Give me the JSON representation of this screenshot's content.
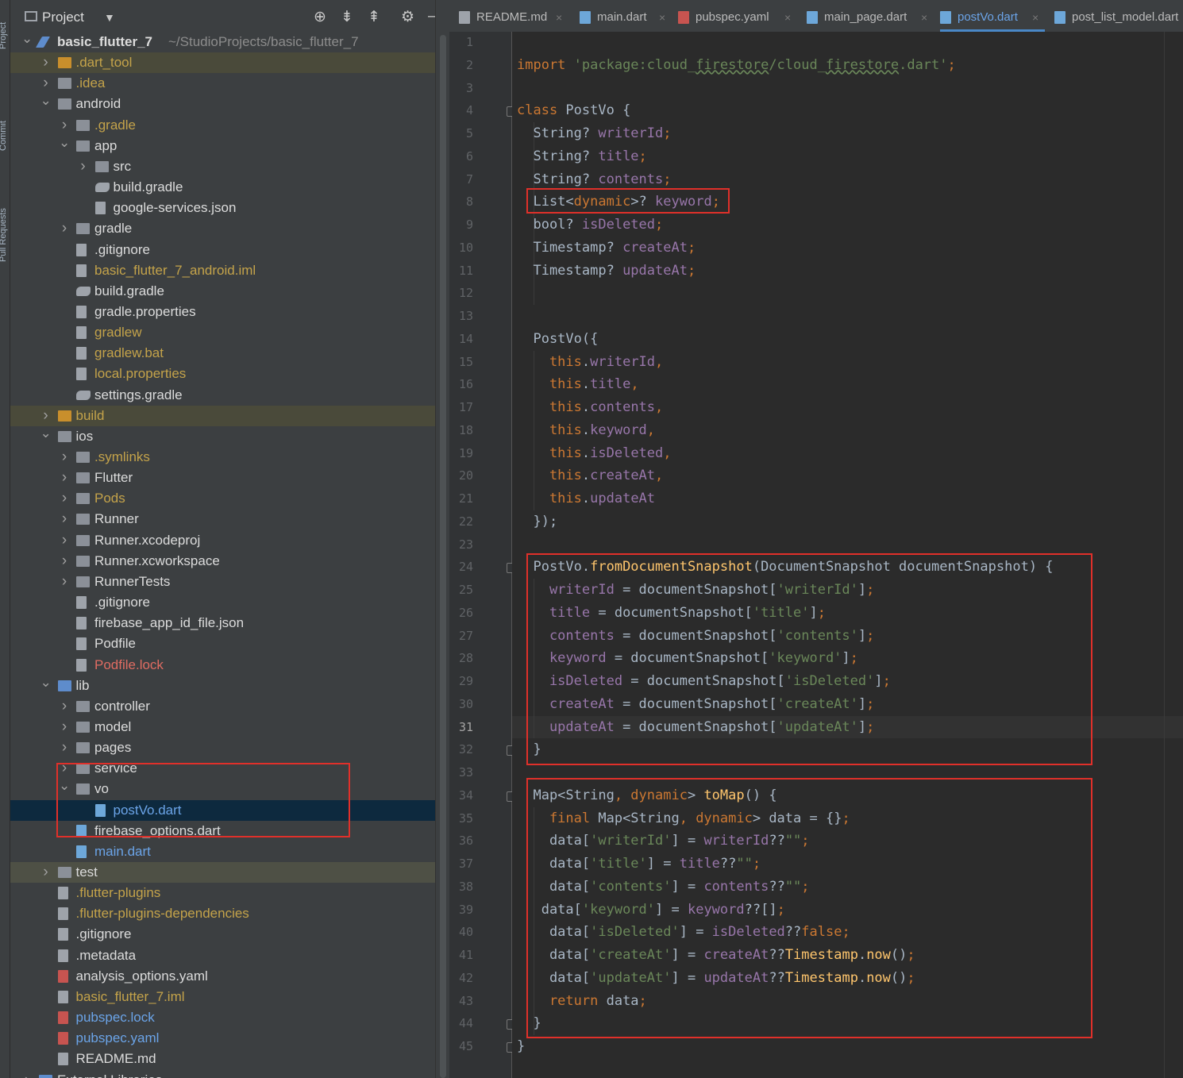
{
  "sidebar_strip": {
    "tabs": [
      "Project",
      "Commit",
      "Pull Requests"
    ]
  },
  "project_panel": {
    "title": "Project",
    "tree": [
      {
        "depth": 0,
        "arrow": "down",
        "icon": "flutter",
        "label": "basic_flutter_7",
        "extra": "~/StudioProjects/basic_flutter_7",
        "color": "norm",
        "bold": true
      },
      {
        "depth": 1,
        "arrow": "right",
        "icon": "folder-orange",
        "label": ".dart_tool",
        "color": "ign",
        "hl": true
      },
      {
        "depth": 1,
        "arrow": "right",
        "icon": "folder",
        "label": ".idea",
        "color": "ign"
      },
      {
        "depth": 1,
        "arrow": "down",
        "icon": "folder",
        "label": "android",
        "color": "norm"
      },
      {
        "depth": 2,
        "arrow": "right",
        "icon": "folder",
        "label": ".gradle",
        "color": "ign"
      },
      {
        "depth": 2,
        "arrow": "down",
        "icon": "folder",
        "label": "app",
        "color": "norm"
      },
      {
        "depth": 3,
        "arrow": "right",
        "icon": "folder",
        "label": "src",
        "color": "norm"
      },
      {
        "depth": 3,
        "arrow": "",
        "icon": "gradle",
        "label": "build.gradle",
        "color": "norm"
      },
      {
        "depth": 3,
        "arrow": "",
        "icon": "file",
        "label": "google-services.json",
        "color": "norm"
      },
      {
        "depth": 2,
        "arrow": "right",
        "icon": "folder",
        "label": "gradle",
        "color": "norm"
      },
      {
        "depth": 2,
        "arrow": "",
        "icon": "file",
        "label": ".gitignore",
        "color": "norm"
      },
      {
        "depth": 2,
        "arrow": "",
        "icon": "file",
        "label": "basic_flutter_7_android.iml",
        "color": "ign"
      },
      {
        "depth": 2,
        "arrow": "",
        "icon": "gradle",
        "label": "build.gradle",
        "color": "norm"
      },
      {
        "depth": 2,
        "arrow": "",
        "icon": "file",
        "label": "gradle.properties",
        "color": "norm"
      },
      {
        "depth": 2,
        "arrow": "",
        "icon": "file",
        "label": "gradlew",
        "color": "ign"
      },
      {
        "depth": 2,
        "arrow": "",
        "icon": "file",
        "label": "gradlew.bat",
        "color": "ign"
      },
      {
        "depth": 2,
        "arrow": "",
        "icon": "file",
        "label": "local.properties",
        "color": "ign"
      },
      {
        "depth": 2,
        "arrow": "",
        "icon": "gradle",
        "label": "settings.gradle",
        "color": "norm"
      },
      {
        "depth": 1,
        "arrow": "right",
        "icon": "folder-orange",
        "label": "build",
        "color": "ign",
        "hl": true
      },
      {
        "depth": 1,
        "arrow": "down",
        "icon": "folder",
        "label": "ios",
        "color": "norm"
      },
      {
        "depth": 2,
        "arrow": "right",
        "icon": "folder",
        "label": ".symlinks",
        "color": "ign"
      },
      {
        "depth": 2,
        "arrow": "right",
        "icon": "folder",
        "label": "Flutter",
        "color": "norm"
      },
      {
        "depth": 2,
        "arrow": "right",
        "icon": "folder",
        "label": "Pods",
        "color": "ign"
      },
      {
        "depth": 2,
        "arrow": "right",
        "icon": "folder",
        "label": "Runner",
        "color": "norm"
      },
      {
        "depth": 2,
        "arrow": "right",
        "icon": "folder",
        "label": "Runner.xcodeproj",
        "color": "norm"
      },
      {
        "depth": 2,
        "arrow": "right",
        "icon": "folder",
        "label": "Runner.xcworkspace",
        "color": "norm"
      },
      {
        "depth": 2,
        "arrow": "right",
        "icon": "folder",
        "label": "RunnerTests",
        "color": "norm"
      },
      {
        "depth": 2,
        "arrow": "",
        "icon": "file",
        "label": ".gitignore",
        "color": "norm"
      },
      {
        "depth": 2,
        "arrow": "",
        "icon": "file",
        "label": "firebase_app_id_file.json",
        "color": "norm"
      },
      {
        "depth": 2,
        "arrow": "",
        "icon": "file",
        "label": "Podfile",
        "color": "norm"
      },
      {
        "depth": 2,
        "arrow": "",
        "icon": "file",
        "label": "Podfile.lock",
        "color": "red"
      },
      {
        "depth": 1,
        "arrow": "down",
        "icon": "folder-blue",
        "label": "lib",
        "color": "norm"
      },
      {
        "depth": 2,
        "arrow": "right",
        "icon": "folder",
        "label": "controller",
        "color": "norm"
      },
      {
        "depth": 2,
        "arrow": "right",
        "icon": "folder",
        "label": "model",
        "color": "norm"
      },
      {
        "depth": 2,
        "arrow": "right",
        "icon": "folder",
        "label": "pages",
        "color": "norm"
      },
      {
        "depth": 2,
        "arrow": "right",
        "icon": "folder",
        "label": "service",
        "color": "norm"
      },
      {
        "depth": 2,
        "arrow": "down",
        "icon": "folder",
        "label": "vo",
        "color": "norm"
      },
      {
        "depth": 3,
        "arrow": "",
        "icon": "dart",
        "label": "postVo.dart",
        "color": "blue",
        "sel": true
      },
      {
        "depth": 2,
        "arrow": "",
        "icon": "dart",
        "label": "firebase_options.dart",
        "color": "norm"
      },
      {
        "depth": 2,
        "arrow": "",
        "icon": "dart",
        "label": "main.dart",
        "color": "blue"
      },
      {
        "depth": 1,
        "arrow": "right",
        "icon": "folder",
        "label": "test",
        "color": "norm",
        "hl2": true
      },
      {
        "depth": 1,
        "arrow": "",
        "icon": "file",
        "label": ".flutter-plugins",
        "color": "ign"
      },
      {
        "depth": 1,
        "arrow": "",
        "icon": "file",
        "label": ".flutter-plugins-dependencies",
        "color": "ign"
      },
      {
        "depth": 1,
        "arrow": "",
        "icon": "file",
        "label": ".gitignore",
        "color": "norm"
      },
      {
        "depth": 1,
        "arrow": "",
        "icon": "file",
        "label": ".metadata",
        "color": "norm"
      },
      {
        "depth": 1,
        "arrow": "",
        "icon": "yaml",
        "label": "analysis_options.yaml",
        "color": "norm"
      },
      {
        "depth": 1,
        "arrow": "",
        "icon": "file",
        "label": "basic_flutter_7.iml",
        "color": "ign"
      },
      {
        "depth": 1,
        "arrow": "",
        "icon": "yaml",
        "label": "pubspec.lock",
        "color": "blue"
      },
      {
        "depth": 1,
        "arrow": "",
        "icon": "yaml",
        "label": "pubspec.yaml",
        "color": "blue"
      },
      {
        "depth": 1,
        "arrow": "",
        "icon": "file",
        "label": "README.md",
        "color": "norm"
      },
      {
        "depth": 0,
        "arrow": "right",
        "icon": "lib",
        "label": "External Libraries",
        "color": "norm"
      }
    ]
  },
  "editor_tabs": [
    {
      "label": "README.md",
      "icon": "md",
      "active": false
    },
    {
      "label": "main.dart",
      "icon": "dart",
      "active": false
    },
    {
      "label": "pubspec.yaml",
      "icon": "yaml",
      "active": false
    },
    {
      "label": "main_page.dart",
      "icon": "dart",
      "active": false
    },
    {
      "label": "postVo.dart",
      "icon": "dart",
      "active": true
    },
    {
      "label": "post_list_model.dart",
      "icon": "dart",
      "active": false
    }
  ],
  "editor": {
    "current_line": 31,
    "lines": [
      [],
      [
        [
          "kw",
          "import "
        ],
        [
          "str",
          "'package:cloud_"
        ],
        [
          "str ul",
          "firestore"
        ],
        [
          "str",
          "/cloud_"
        ],
        [
          "str ul",
          "firestore"
        ],
        [
          "str",
          ".dart'"
        ],
        [
          "kw",
          ";"
        ]
      ],
      [],
      [
        [
          "kw",
          "class "
        ],
        [
          "ty",
          "PostVo {"
        ]
      ],
      [
        [
          "ty",
          "  String? "
        ],
        [
          "fld",
          "writerId"
        ],
        [
          "kw",
          ";"
        ]
      ],
      [
        [
          "ty",
          "  String? "
        ],
        [
          "fld",
          "title"
        ],
        [
          "kw",
          ";"
        ]
      ],
      [
        [
          "ty",
          "  String? "
        ],
        [
          "fld",
          "contents"
        ],
        [
          "kw",
          ";"
        ]
      ],
      [
        [
          "ty",
          "  List<"
        ],
        [
          "kw",
          "dynamic"
        ],
        [
          "ty",
          ">? "
        ],
        [
          "fld",
          "keyword"
        ],
        [
          "kw",
          ";"
        ]
      ],
      [
        [
          "ty",
          "  bool? "
        ],
        [
          "fld",
          "isDeleted"
        ],
        [
          "kw",
          ";"
        ]
      ],
      [
        [
          "ty",
          "  Timestamp? "
        ],
        [
          "fld",
          "createAt"
        ],
        [
          "kw",
          ";"
        ]
      ],
      [
        [
          "ty",
          "  Timestamp? "
        ],
        [
          "fld",
          "updateAt"
        ],
        [
          "kw",
          ";"
        ]
      ],
      [],
      [],
      [
        [
          "ty",
          "  PostVo({"
        ]
      ],
      [
        [
          "kw",
          "    this"
        ],
        [
          "ty",
          "."
        ],
        [
          "fld",
          "writerId"
        ],
        [
          "kw",
          ","
        ]
      ],
      [
        [
          "kw",
          "    this"
        ],
        [
          "ty",
          "."
        ],
        [
          "fld",
          "title"
        ],
        [
          "kw",
          ","
        ]
      ],
      [
        [
          "kw",
          "    this"
        ],
        [
          "ty",
          "."
        ],
        [
          "fld",
          "contents"
        ],
        [
          "kw",
          ","
        ]
      ],
      [
        [
          "kw",
          "    this"
        ],
        [
          "ty",
          "."
        ],
        [
          "fld",
          "keyword"
        ],
        [
          "kw",
          ","
        ]
      ],
      [
        [
          "kw",
          "    this"
        ],
        [
          "ty",
          "."
        ],
        [
          "fld",
          "isDeleted"
        ],
        [
          "kw",
          ","
        ]
      ],
      [
        [
          "kw",
          "    this"
        ],
        [
          "ty",
          "."
        ],
        [
          "fld",
          "createAt"
        ],
        [
          "kw",
          ","
        ]
      ],
      [
        [
          "kw",
          "    this"
        ],
        [
          "ty",
          "."
        ],
        [
          "fld",
          "updateAt"
        ]
      ],
      [
        [
          "ty",
          "  });"
        ]
      ],
      [],
      [
        [
          "ty",
          "  PostVo."
        ],
        [
          "fn",
          "fromDocumentSnapshot"
        ],
        [
          "ty",
          "(DocumentSnapshot documentSnapshot) {"
        ]
      ],
      [
        [
          "fld",
          "    writerId"
        ],
        [
          "ty",
          " = documentSnapshot["
        ],
        [
          "str",
          "'writerId'"
        ],
        [
          "ty",
          "]"
        ],
        [
          "kw",
          ";"
        ]
      ],
      [
        [
          "fld",
          "    title"
        ],
        [
          "ty",
          " = documentSnapshot["
        ],
        [
          "str",
          "'title'"
        ],
        [
          "ty",
          "]"
        ],
        [
          "kw",
          ";"
        ]
      ],
      [
        [
          "fld",
          "    contents"
        ],
        [
          "ty",
          " = documentSnapshot["
        ],
        [
          "str",
          "'contents'"
        ],
        [
          "ty",
          "]"
        ],
        [
          "kw",
          ";"
        ]
      ],
      [
        [
          "fld",
          "    keyword"
        ],
        [
          "ty",
          " = documentSnapshot["
        ],
        [
          "str",
          "'keyword'"
        ],
        [
          "ty",
          "]"
        ],
        [
          "kw",
          ";"
        ]
      ],
      [
        [
          "fld",
          "    isDeleted"
        ],
        [
          "ty",
          " = documentSnapshot["
        ],
        [
          "str",
          "'isDeleted'"
        ],
        [
          "ty",
          "]"
        ],
        [
          "kw",
          ";"
        ]
      ],
      [
        [
          "fld",
          "    createAt"
        ],
        [
          "ty",
          " = documentSnapshot["
        ],
        [
          "str",
          "'createAt'"
        ],
        [
          "ty",
          "]"
        ],
        [
          "kw",
          ";"
        ]
      ],
      [
        [
          "fld",
          "    updateAt"
        ],
        [
          "ty",
          " = documentSnapshot["
        ],
        [
          "str",
          "'updateAt'"
        ],
        [
          "ty",
          "]"
        ],
        [
          "kw",
          ";"
        ]
      ],
      [
        [
          "ty",
          "  }"
        ]
      ],
      [],
      [
        [
          "ty",
          "  Map<String"
        ],
        [
          "kw",
          ", dynamic"
        ],
        [
          "ty",
          "> "
        ],
        [
          "fn",
          "toMap"
        ],
        [
          "ty",
          "() {"
        ]
      ],
      [
        [
          "kw",
          "    final "
        ],
        [
          "ty",
          "Map<String"
        ],
        [
          "kw",
          ", dynamic"
        ],
        [
          "ty",
          "> data = {}"
        ],
        [
          "kw",
          ";"
        ]
      ],
      [
        [
          "ty",
          "    data["
        ],
        [
          "str",
          "'writerId'"
        ],
        [
          "ty",
          "] = "
        ],
        [
          "fld",
          "writerId"
        ],
        [
          "ty",
          "??"
        ],
        [
          "str",
          "\"\""
        ],
        [
          "kw",
          ";"
        ]
      ],
      [
        [
          "ty",
          "    data["
        ],
        [
          "str",
          "'title'"
        ],
        [
          "ty",
          "] = "
        ],
        [
          "fld",
          "title"
        ],
        [
          "ty",
          "??"
        ],
        [
          "str",
          "\"\""
        ],
        [
          "kw",
          ";"
        ]
      ],
      [
        [
          "ty",
          "    data["
        ],
        [
          "str",
          "'contents'"
        ],
        [
          "ty",
          "] = "
        ],
        [
          "fld",
          "contents"
        ],
        [
          "ty",
          "??"
        ],
        [
          "str",
          "\"\""
        ],
        [
          "kw",
          ";"
        ]
      ],
      [
        [
          "ty",
          "   data["
        ],
        [
          "str",
          "'keyword'"
        ],
        [
          "ty",
          "] = "
        ],
        [
          "fld",
          "keyword"
        ],
        [
          "ty",
          "??[]"
        ],
        [
          "kw",
          ";"
        ]
      ],
      [
        [
          "ty",
          "    data["
        ],
        [
          "str",
          "'isDeleted'"
        ],
        [
          "ty",
          "] = "
        ],
        [
          "fld",
          "isDeleted"
        ],
        [
          "ty",
          "??"
        ],
        [
          "kw",
          "false;"
        ]
      ],
      [
        [
          "ty",
          "    data["
        ],
        [
          "str",
          "'createAt'"
        ],
        [
          "ty",
          "] = "
        ],
        [
          "fld",
          "createAt"
        ],
        [
          "ty",
          "??"
        ],
        [
          "fn",
          "Timestamp"
        ],
        [
          "ty",
          "."
        ],
        [
          "fn",
          "now"
        ],
        [
          "ty",
          "()"
        ],
        [
          "kw",
          ";"
        ]
      ],
      [
        [
          "ty",
          "    data["
        ],
        [
          "str",
          "'updateAt'"
        ],
        [
          "ty",
          "] = "
        ],
        [
          "fld",
          "updateAt"
        ],
        [
          "ty",
          "??"
        ],
        [
          "fn",
          "Timestamp"
        ],
        [
          "ty",
          "."
        ],
        [
          "fn",
          "now"
        ],
        [
          "ty",
          "()"
        ],
        [
          "kw",
          ";"
        ]
      ],
      [
        [
          "kw",
          "    return "
        ],
        [
          "ty",
          "data"
        ],
        [
          "kw",
          ";"
        ]
      ],
      [
        [
          "ty",
          "  }"
        ]
      ],
      [
        [
          "ty",
          "}"
        ]
      ]
    ]
  },
  "colors": {
    "highlight_box": "#e0302a",
    "active_tab": "#4a88c7"
  },
  "icons": {
    "target": "locate-icon",
    "expand": "expand-all-icon",
    "collapse": "collapse-all-icon",
    "settings": "gear-icon",
    "hide": "hide-icon"
  }
}
